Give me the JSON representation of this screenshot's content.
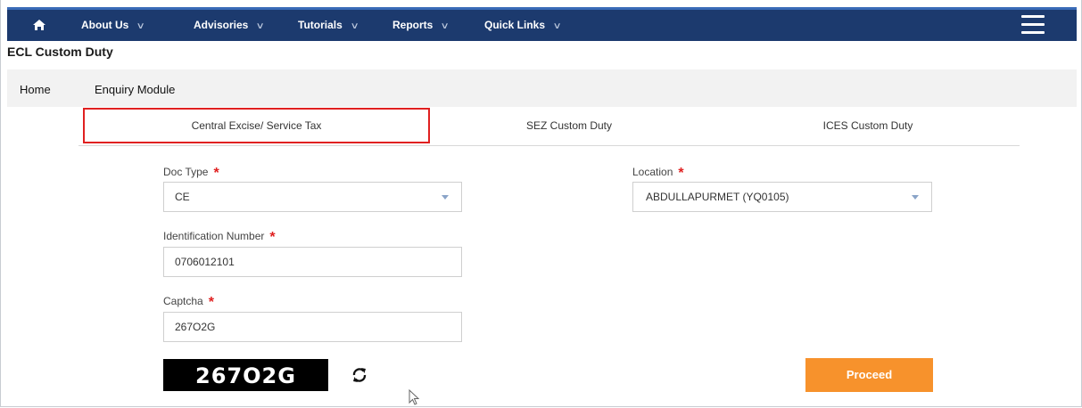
{
  "navbar": {
    "home_icon": "home-icon",
    "items": [
      {
        "label": "About Us"
      },
      {
        "label": "Advisories"
      },
      {
        "label": "Tutorials"
      },
      {
        "label": "Reports"
      },
      {
        "label": "Quick Links"
      }
    ],
    "chevron": "∨",
    "menu_icon": "hamburger-menu-icon",
    "bg_color": "#1c3a6e"
  },
  "app_title": "ECL Custom Duty",
  "menu": {
    "home": "Home",
    "enquiry": "Enquiry Module"
  },
  "tabs": [
    {
      "label": "Central Excise/ Service Tax",
      "active": true
    },
    {
      "label": "SEZ Custom Duty"
    },
    {
      "label": "ICES Custom Duty"
    }
  ],
  "form": {
    "doc_type": {
      "label": "Doc Type",
      "value": "CE",
      "required": "*"
    },
    "location": {
      "label": "Location",
      "value": "ABDULLAPURMET (YQ0105)",
      "required": "*"
    },
    "identification": {
      "label": "Identification Number",
      "value": "0706012101",
      "required": "*"
    },
    "captcha": {
      "label": "Captcha",
      "value": "267O2G",
      "required": "*"
    },
    "captcha_image_text": "267O2G",
    "refresh_icon": "refresh-icon",
    "proceed_label": "Proceed",
    "proceed_color": "#f7922c",
    "required_color": "#e02020"
  }
}
